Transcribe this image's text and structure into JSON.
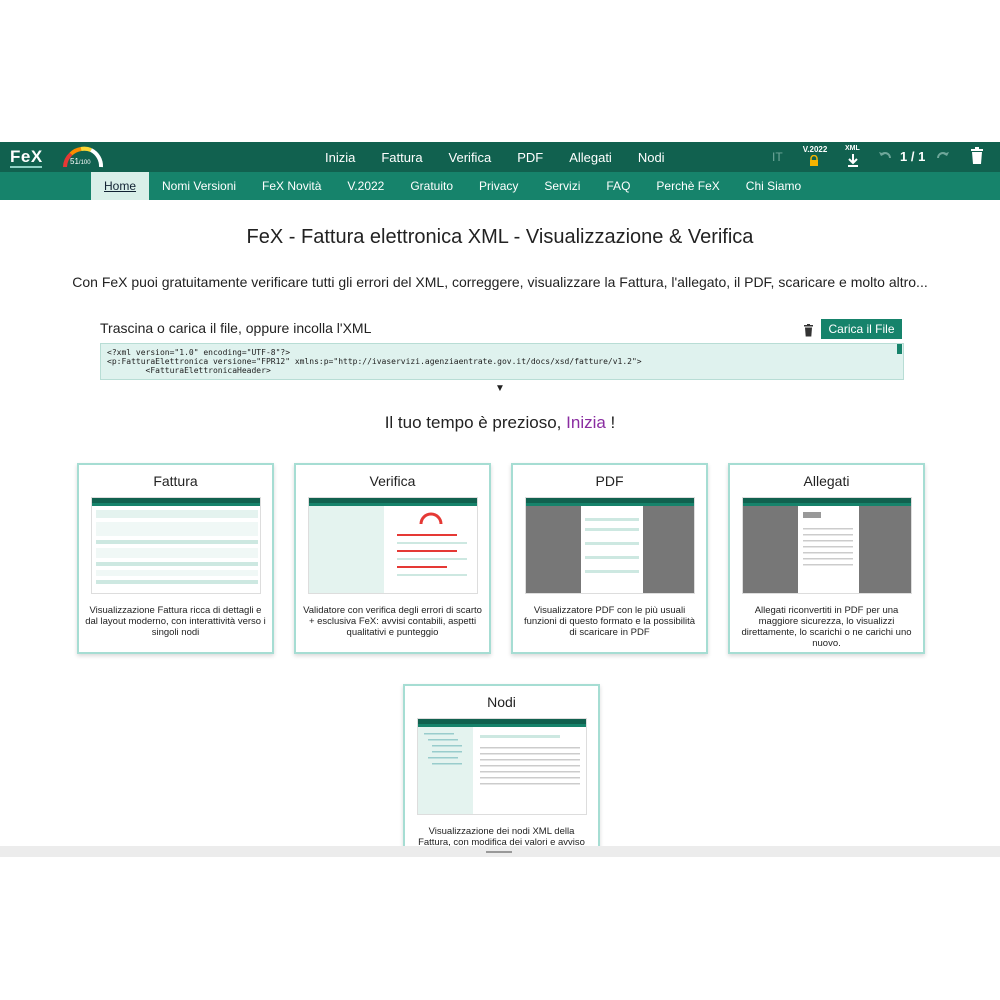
{
  "topbar": {
    "logo": "FeX",
    "score": "51",
    "score_max": "/100",
    "nav": [
      "Inizia",
      "Fattura",
      "Verifica",
      "PDF",
      "Allegati",
      "Nodi"
    ],
    "lang": "IT",
    "version": "V.2022",
    "xml_label": "XML",
    "page_count": "1 / 1"
  },
  "subnav": [
    "Home",
    "Nomi Versioni",
    "FeX Novità",
    "V.2022",
    "Gratuito",
    "Privacy",
    "Servizi",
    "FAQ",
    "Perchè FeX",
    "Chi Siamo"
  ],
  "main": {
    "title": "FeX - Fattura elettronica XML - Visualizzazione & Verifica",
    "subtitle": "Con FeX puoi gratuitamente verificare tutti gli errori del XML, correggere, visualizzare la Fattura, l'allegato, il PDF, scaricare e molto altro...",
    "drop_label": "Trascina o carica il file, oppure incolla l'XML",
    "upload_button": "Carica il File",
    "xml_text": "<?xml version=\"1.0\" encoding=\"UTF-8\"?>\n<p:FatturaElettronica versione=\"FPR12\" xmlns:p=\"http://ivaservizi.agenziaentrate.gov.it/docs/xsd/fatture/v1.2\">\n        <FatturaElettronicaHeader>",
    "expand_arrow": "▼",
    "tagline_prefix": "Il tuo tempo è prezioso, ",
    "tagline_link": "Inizia",
    "tagline_suffix": " !"
  },
  "cards": [
    {
      "title": "Fattura",
      "desc": "Visualizzazione Fattura ricca di dettagli e dal layout moderno, con interattività verso i singoli nodi"
    },
    {
      "title": "Verifica",
      "desc": "Validatore con verifica degli errori di scarto + esclusiva FeX: avvisi contabili, aspetti qualitativi e punteggio"
    },
    {
      "title": "PDF",
      "desc": "Visualizzatore PDF con le più usuali funzioni di questo formato e la possibilità di scaricare in PDF"
    },
    {
      "title": "Allegati",
      "desc": "Allegati riconvertiti in PDF per una maggiore sicurezza, lo visualizzi direttamente, lo scarichi o ne carichi uno nuovo."
    },
    {
      "title": "Nodi",
      "desc": "Visualizzazione dei nodi XML della Fattura, con modifica dei valori e avviso"
    }
  ],
  "colors": {
    "topbar": "#11614f",
    "subnav": "#16836b",
    "accent_border": "#a6ddd3",
    "link": "#8a2da1"
  }
}
